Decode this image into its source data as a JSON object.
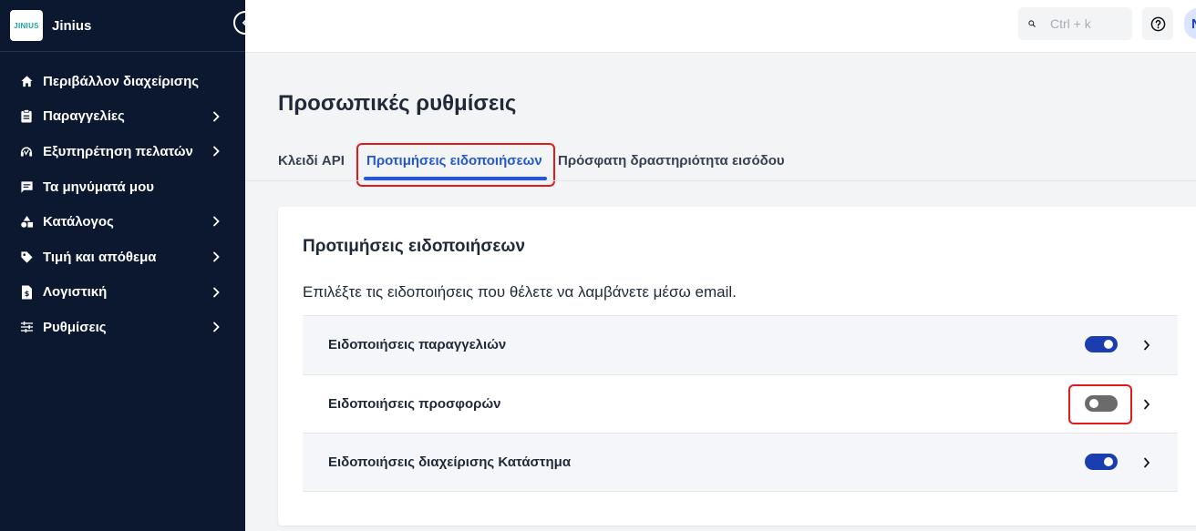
{
  "app": {
    "brand_name": "Jinius",
    "logo_text": "JINIUS"
  },
  "sidebar": {
    "items": [
      {
        "label": "Περιβάλλον διαχείρισης",
        "icon": "home-icon",
        "has_chevron": false
      },
      {
        "label": "Παραγγελίες",
        "icon": "clipboard-icon",
        "has_chevron": true
      },
      {
        "label": "Εξυπηρέτηση πελατών",
        "icon": "headset-icon",
        "has_chevron": true
      },
      {
        "label": "Τα μηνύματά μου",
        "icon": "message-icon",
        "has_chevron": false
      },
      {
        "label": "Κατάλογος",
        "icon": "shapes-icon",
        "has_chevron": true
      },
      {
        "label": "Τιμή και απόθεμα",
        "icon": "tag-icon",
        "has_chevron": true
      },
      {
        "label": "Λογιστική",
        "icon": "invoice-icon",
        "has_chevron": true
      },
      {
        "label": "Ρυθμίσεις",
        "icon": "sliders-icon",
        "has_chevron": true
      }
    ]
  },
  "topbar": {
    "search_placeholder": "Ctrl + k",
    "avatar_initial": "N"
  },
  "page": {
    "title": "Προσωπικές ρυθμίσεις",
    "tabs": [
      {
        "label": "Κλειδί API",
        "active": false
      },
      {
        "label": "Προτιμήσεις ειδοποιήσεων",
        "active": true
      },
      {
        "label": "Πρόσφατη δραστηριότητα εισόδου",
        "active": false
      }
    ]
  },
  "card": {
    "title": "Προτιμήσεις ειδοποιήσεων",
    "description": "Επιλέξτε τις ειδοποιήσεις που θέλετε να λαμβάνετε μέσω email.",
    "rows": [
      {
        "label": "Ειδοποιήσεις παραγγελιών",
        "enabled": true
      },
      {
        "label": "Ειδοποιήσεις προσφορών",
        "enabled": false
      },
      {
        "label": "Ειδοποιήσεις διαχείρισης Κατάστημα",
        "enabled": true
      }
    ]
  },
  "colors": {
    "sidebar_bg": "#0b1830",
    "accent": "#2457d6",
    "toggle_on": "#1a3db0",
    "toggle_off": "#6b6b6b",
    "highlight": "#e01b1b"
  }
}
